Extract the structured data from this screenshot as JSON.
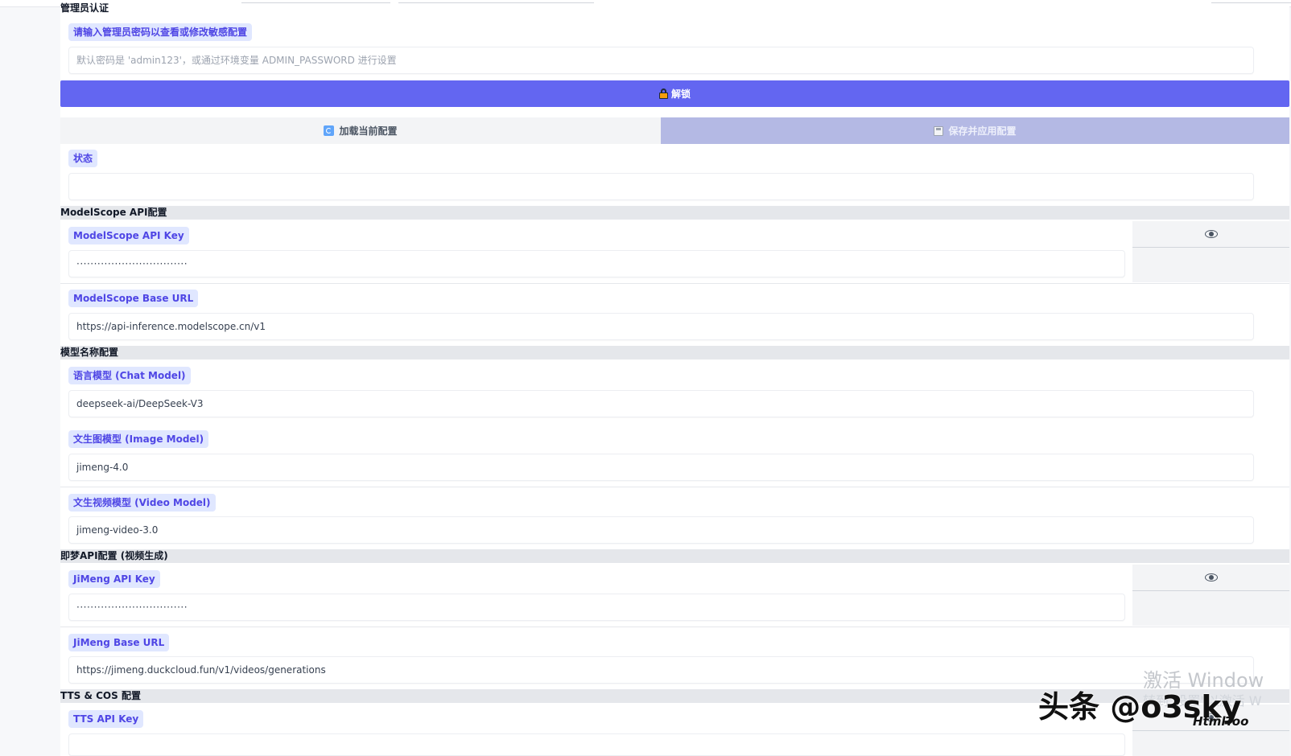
{
  "admin": {
    "section_title": "管理员认证",
    "password_label": "请输入管理员密码以查看或修改敏感配置",
    "password_placeholder": "默认密码是 'admin123'，或通过环境变量 ADMIN_PASSWORD 进行设置",
    "unlock_label": "解锁"
  },
  "actions": {
    "load_label": "加载当前配置",
    "save_label": "保存并应用配置"
  },
  "status": {
    "label": "状态",
    "value": ""
  },
  "modelscope": {
    "section_title": "ModelScope API配置",
    "api_key_label": "ModelScope API Key",
    "api_key_value": "································",
    "base_url_label": "ModelScope Base URL",
    "base_url_value": "https://api-inference.modelscope.cn/v1"
  },
  "models": {
    "section_title": "模型名称配置",
    "chat_label": "语言模型 (Chat Model)",
    "chat_value": "deepseek-ai/DeepSeek-V3",
    "image_label": "文生图模型 (Image Model)",
    "image_value": "jimeng-4.0",
    "video_label": "文生视频模型 (Video Model)",
    "video_value": "jimeng-video-3.0"
  },
  "jimeng": {
    "section_title": "即梦API配置 (视频生成)",
    "api_key_label": "JiMeng API Key",
    "api_key_value": "································",
    "base_url_label": "JiMeng Base URL",
    "base_url_value": "https://jimeng.duckcloud.fun/v1/videos/generations"
  },
  "tts": {
    "section_title": "TTS & COS 配置",
    "api_key_label": "TTS API Key"
  },
  "watermark": {
    "windows_line1": "激活 Window",
    "windows_line2": "转到\"设置\"以激活 W",
    "brand": "头条 @o3sky",
    "sub": "HtmlToo"
  },
  "icons": {
    "unlock": "lock-icon",
    "load": "refresh-icon",
    "save": "save-disk-icon",
    "toggle_visibility": "eye-icon"
  },
  "colors": {
    "accent": "#6366f1",
    "chip_bg": "#e0e7ff",
    "chip_text": "#4f46e5",
    "save_disabled": "#b4b9e4"
  }
}
